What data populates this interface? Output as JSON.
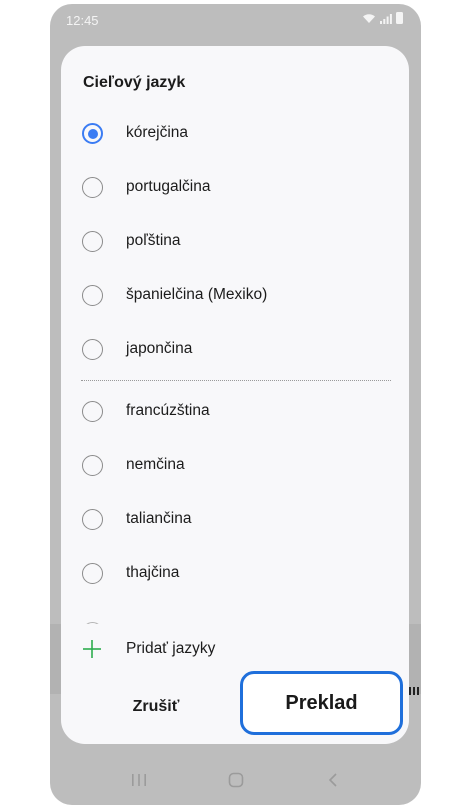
{
  "status_bar": {
    "time": "12:45",
    "icons": [
      "wifi-icon",
      "signal-icon",
      "battery-icon"
    ]
  },
  "dialog": {
    "title": "Cieľový jazyk",
    "options": [
      {
        "label": "kórejčina",
        "selected": true
      },
      {
        "label": "portugalčina",
        "selected": false
      },
      {
        "label": "poľština",
        "selected": false
      },
      {
        "label": "španielčina (Mexiko)",
        "selected": false
      },
      {
        "label": "japončina",
        "selected": false
      },
      {
        "label": "francúzština",
        "selected": false
      },
      {
        "label": "nemčina",
        "selected": false
      },
      {
        "label": "taliančina",
        "selected": false
      },
      {
        "label": "thajčina",
        "selected": false
      }
    ],
    "add_languages_label": "Pridať jazyky",
    "cancel_label": "Zrušiť",
    "translate_label": "Preklad"
  },
  "nav_bar": {
    "items": [
      "recents-icon",
      "home-icon",
      "back-icon"
    ]
  },
  "colors": {
    "accent": "#3b7cf3",
    "highlight_border": "#1f6fdb",
    "plus": "#2fae4f"
  }
}
